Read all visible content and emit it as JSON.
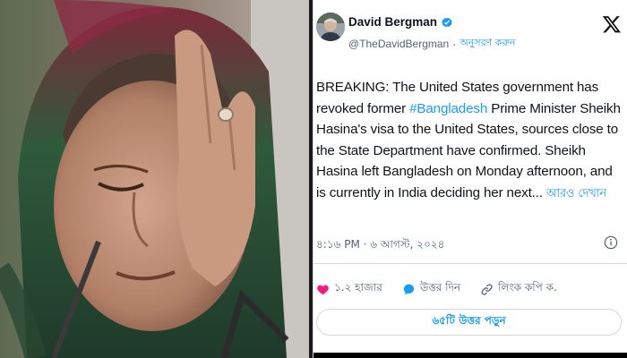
{
  "author": {
    "name": "David Bergman",
    "handle": "@TheDavidBergman",
    "separator": "·",
    "follow_label": "অনুসরণ করুন"
  },
  "tweet": {
    "text_before": "BREAKING:  The United States government has revoked former ",
    "hashtag": "#Bangladesh",
    "text_after": " Prime Minister Sheikh Hasina's visa to the United States, sources close to the State Department have confirmed. Sheikh Hasina left Bangladesh on Monday afternoon, and is currently in India deciding her next...",
    "more_label": "আরও দেখান",
    "timestamp": "৪:১৬ PM · ৬ আগস্ট, ২০২৪"
  },
  "actions": {
    "like_count": "১.২ হাজার",
    "reply_label": "উত্তর দিন",
    "copy_link_label": "লিংক কপি ক."
  },
  "read_replies_label": "৬৫টি উত্তর পড়ুন",
  "colors": {
    "accent": "#1d9bf0",
    "like": "#f91880",
    "text": "#0f1419",
    "muted": "#536471"
  },
  "icons": [
    "verified-badge-icon",
    "x-logo-icon",
    "info-icon",
    "heart-icon",
    "reply-bubble-icon",
    "link-icon"
  ]
}
